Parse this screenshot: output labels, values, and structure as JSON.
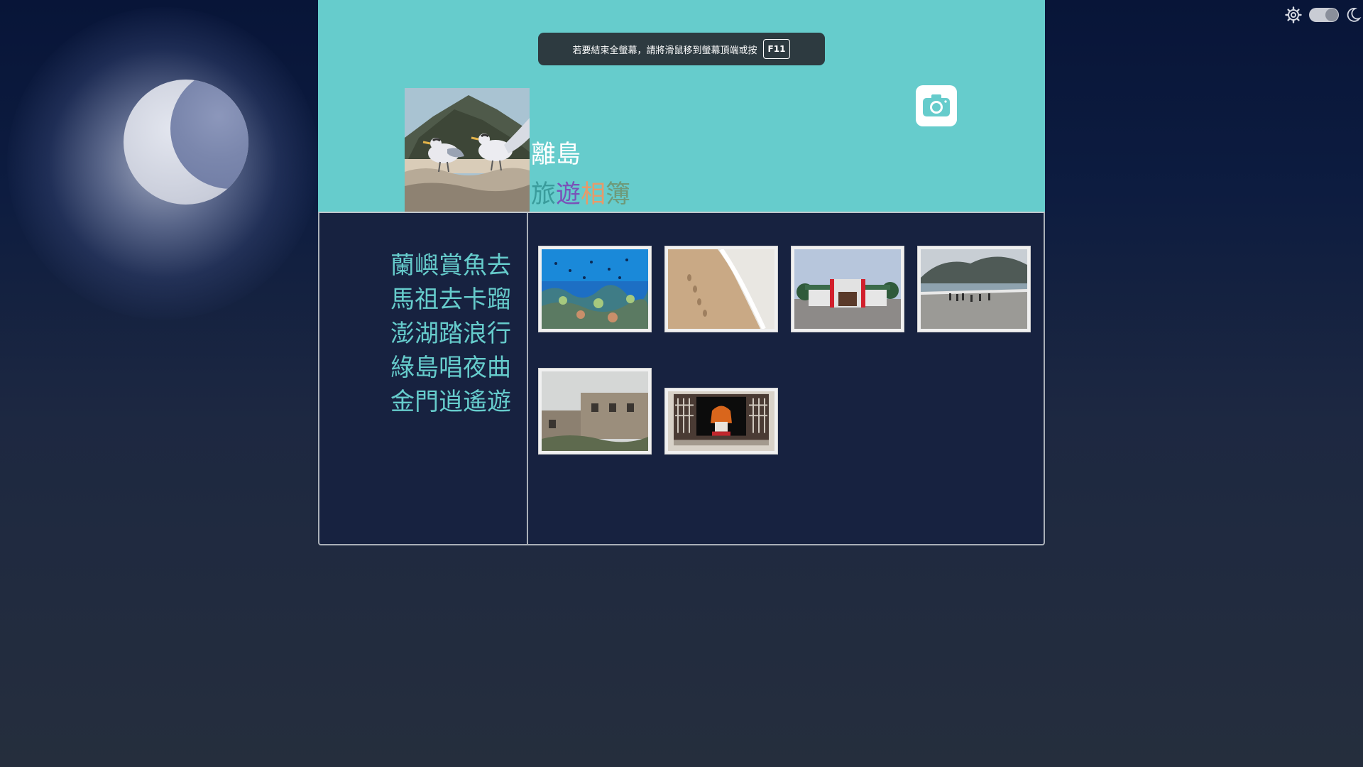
{
  "fullscreen_notice": {
    "message": "若要結束全螢幕，請將滑鼠移到螢幕頂端或按",
    "key": "F11"
  },
  "header": {
    "title": "離島",
    "subtitle_chars": [
      {
        "char": "旅",
        "color": "#3a9c9c"
      },
      {
        "char": "遊",
        "color": "#7a52b8"
      },
      {
        "char": "相",
        "color": "#e79a6a"
      },
      {
        "char": "簿",
        "color": "#6e9a7a"
      }
    ]
  },
  "menu": {
    "items": [
      {
        "label": "蘭嶼賞魚去"
      },
      {
        "label": "馬祖去卡蹓"
      },
      {
        "label": "澎湖踏浪行"
      },
      {
        "label": "綠島唱夜曲"
      },
      {
        "label": "金門逍遙遊"
      }
    ]
  },
  "gallery": {
    "photos": [
      {
        "subject": "coral-reef-fish"
      },
      {
        "subject": "beach-footprints"
      },
      {
        "subject": "red-gate-memorial"
      },
      {
        "subject": "coastal-walkway-crowd"
      },
      {
        "subject": "stone-houses"
      },
      {
        "subject": "window-character"
      }
    ]
  },
  "colors": {
    "header_bg": "#66cccc",
    "content_bg": "#172240",
    "menu_text": "#66cccc"
  }
}
